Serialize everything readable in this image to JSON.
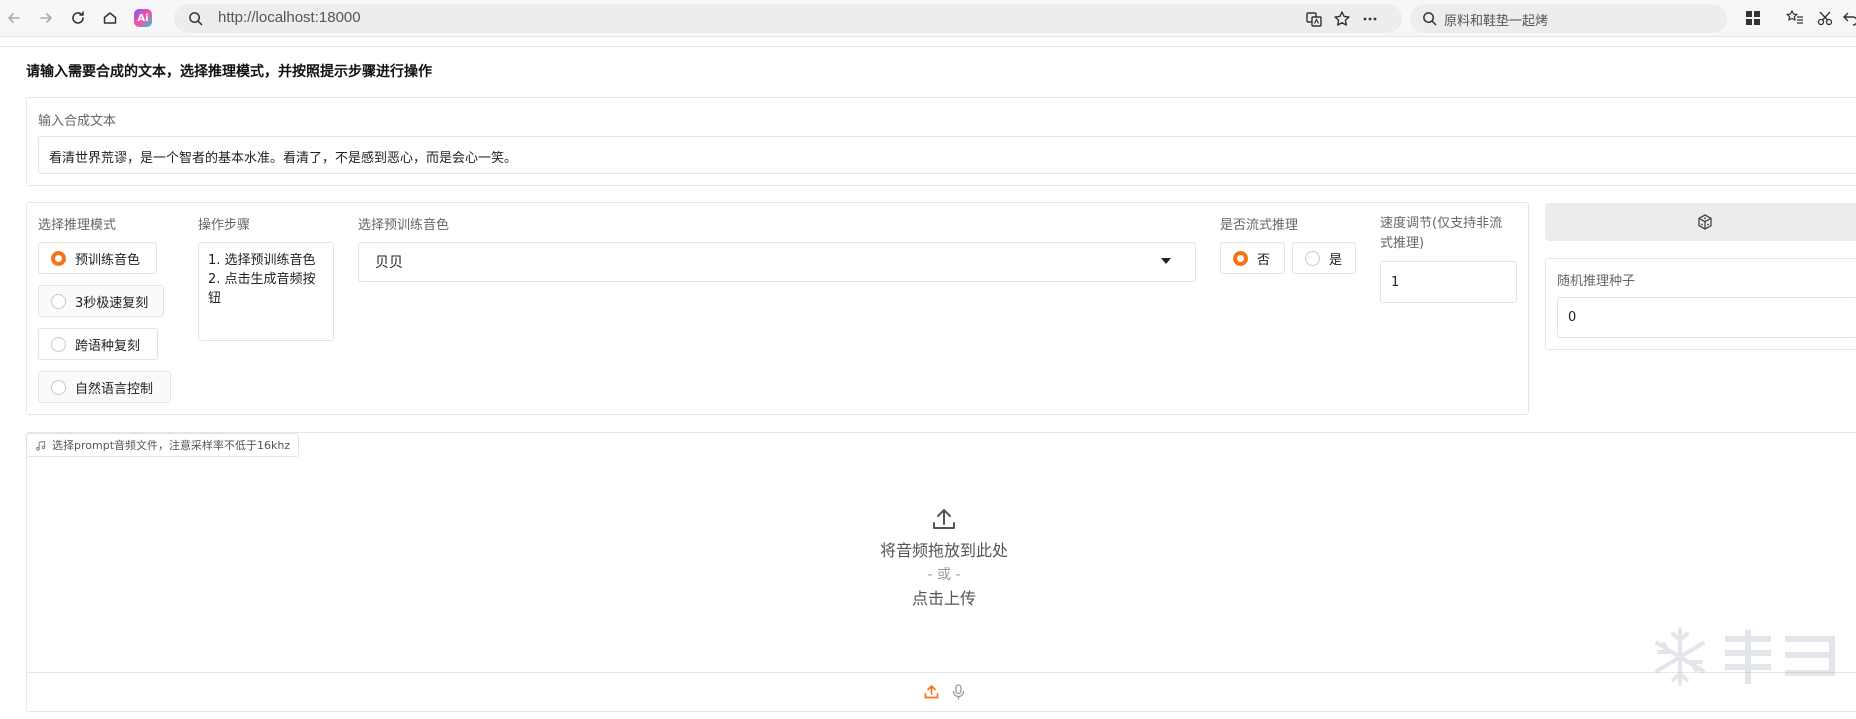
{
  "browser": {
    "url": "http://localhost:18000",
    "search_text": "原料和鞋垫一起烤",
    "ai_badge": "Ai"
  },
  "page": {
    "title": "请输入需要合成的文本，选择推理模式，并按照提示步骤进行操作"
  },
  "synth_text": {
    "label": "输入合成文本",
    "value": "看清世界荒谬，是一个智者的基本水准。看清了，不是感到恶心，而是会心一笑。"
  },
  "mode": {
    "label": "选择推理模式",
    "options": [
      "预训练音色",
      "3秒极速复刻",
      "跨语种复刻",
      "自然语言控制"
    ],
    "selected": "预训练音色"
  },
  "steps": {
    "label": "操作步骤",
    "line1": "1. 选择预训练音色",
    "line2": "2. 点击生成音频按",
    "line3": "钮"
  },
  "voice": {
    "label": "选择预训练音色",
    "selected": "贝贝"
  },
  "streaming": {
    "label": "是否流式推理",
    "options": [
      "否",
      "是"
    ],
    "selected": "否"
  },
  "speed": {
    "label_line1": "速度调节(仅支持非流",
    "label_line2": "式推理)",
    "value": "1"
  },
  "seed": {
    "label": "随机推理种子",
    "value": "0"
  },
  "upload": {
    "tag": "选择prompt音频文件，注意采样率不低于16khz",
    "drop": "将音频拖放到此处",
    "or": "- 或 -",
    "click": "点击上传"
  },
  "colors": {
    "accent": "#f97316"
  }
}
